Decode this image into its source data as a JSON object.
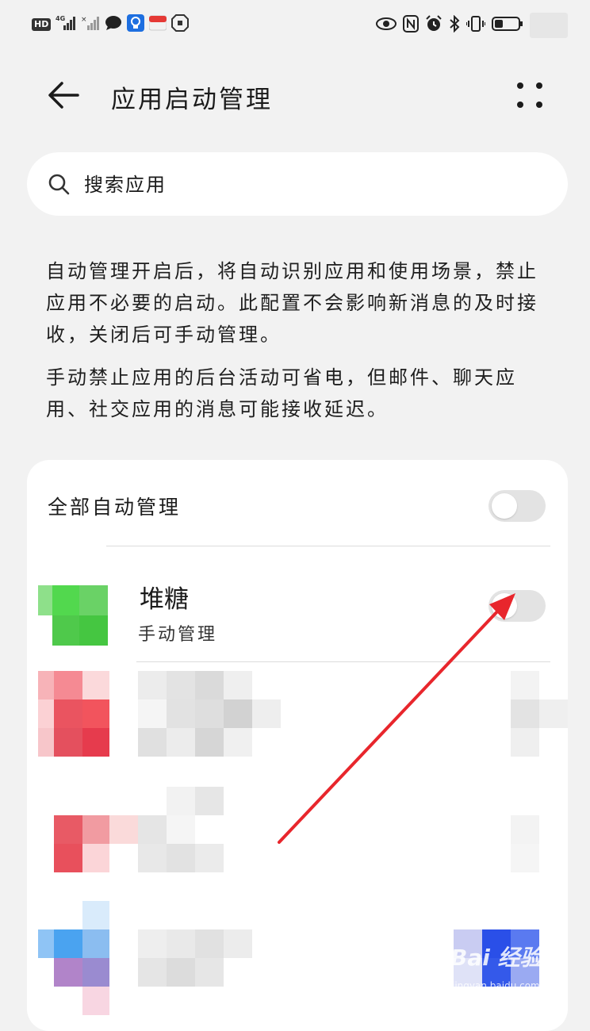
{
  "status_bar": {
    "hd_label": "HD",
    "network_label": "4G",
    "icons": [
      "hd-icon",
      "signal-icon",
      "signal-no-sim-icon",
      "chat-bubble-icon",
      "lightbulb-app-icon",
      "red-app-icon",
      "shield-app-icon",
      "eye-icon",
      "nfc-icon",
      "alarm-icon",
      "bluetooth-icon",
      "vibrate-icon",
      "battery-icon"
    ]
  },
  "header": {
    "title": "应用启动管理",
    "back_icon": "back-arrow-icon",
    "more_icon": "more-dots-icon"
  },
  "search": {
    "placeholder": "搜索应用",
    "icon": "search-icon"
  },
  "description": {
    "paragraph_1": "自动管理开启后，将自动识别应用和使用场景，禁止应用不必要的启动。此配置不会影响新消息的及时接收，关闭后可手动管理。",
    "paragraph_2": "手动禁止应用的后台活动可省电，但邮件、聊天应用、社交应用的消息可能接收延迟。"
  },
  "card": {
    "all_auto_label": "全部自动管理",
    "all_auto_enabled": false,
    "apps": [
      {
        "name": "堆糖",
        "status": "手动管理",
        "enabled": false,
        "icon_color": "#4fc94b"
      }
    ]
  },
  "colors": {
    "background": "#f2f2f2",
    "card": "#ffffff",
    "toggle_off": "#e3e3e3",
    "annotation_arrow": "#e8262c"
  },
  "watermark": {
    "brand": "Bai 经验",
    "url": "jingyan.baidu.com"
  }
}
